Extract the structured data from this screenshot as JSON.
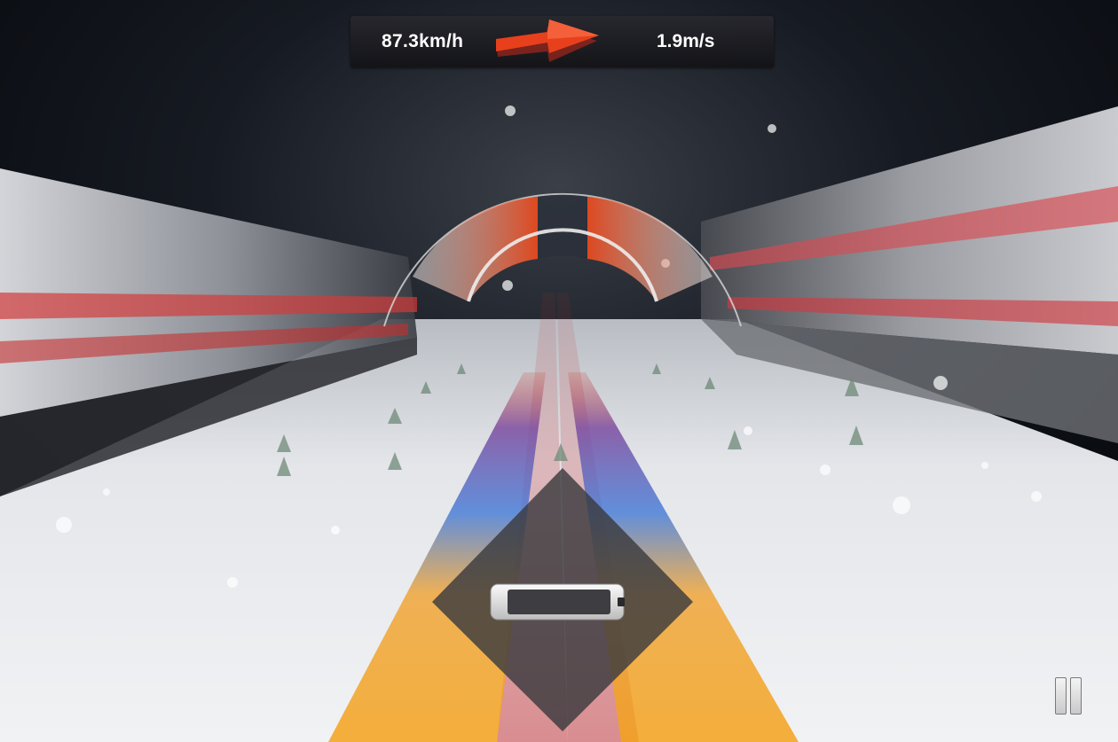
{
  "hud": {
    "speed": "87.3km/h",
    "wind_speed": "1.9m/s",
    "wind_direction_icon": "wind-arrow-icon"
  },
  "colors": {
    "accent_red": "#e8401c",
    "sky": "#0e1118",
    "snow": "#e6e8ec",
    "ski_orange": "#f29a12",
    "ski_blue": "#3f77d6"
  },
  "controls": {
    "pause_icon": "pause-icon",
    "balance_gauge_icon": "balance-gauge-icon",
    "timing_arc_icon": "timing-arc-icon",
    "battery_indicator_icon": "battery-indicator-icon"
  }
}
